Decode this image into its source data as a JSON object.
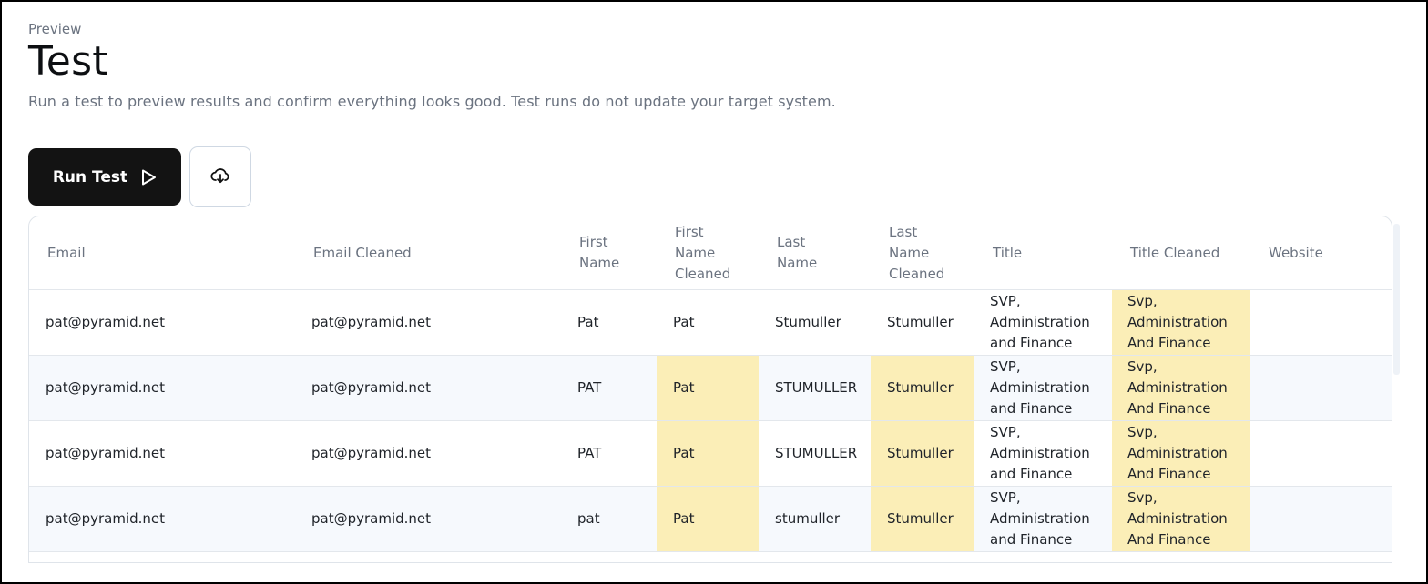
{
  "header": {
    "eyebrow": "Preview",
    "title": "Test",
    "subtitle": "Run a test to preview results and confirm everything looks good. Test runs do not update your target system."
  },
  "toolbar": {
    "run_label": "Run Test",
    "run_icon": "play-icon",
    "download_icon": "cloud-download-icon"
  },
  "colors": {
    "highlight": "#fbeeb7",
    "button": "#131313",
    "alt_row": "#f6f9fd"
  },
  "table": {
    "columns": [
      {
        "lines": [
          "Email"
        ]
      },
      {
        "lines": [
          "Email Cleaned"
        ]
      },
      {
        "lines": [
          "First",
          "Name"
        ]
      },
      {
        "lines": [
          "First",
          "Name",
          "Cleaned"
        ]
      },
      {
        "lines": [
          "Last",
          "Name"
        ]
      },
      {
        "lines": [
          "Last",
          "Name",
          "Cleaned"
        ]
      },
      {
        "lines": [
          "Title"
        ]
      },
      {
        "lines": [
          "Title Cleaned"
        ]
      },
      {
        "lines": [
          "Website"
        ]
      }
    ],
    "rows": [
      {
        "email": "pat@pyramid.net",
        "email_cleaned": "pat@pyramid.net",
        "first": "Pat",
        "first_cleaned": "Pat",
        "last": "Stumuller",
        "last_cleaned": "Stumuller",
        "title": [
          "SVP,",
          "Administration",
          "and Finance"
        ],
        "title_cleaned": [
          "Svp,",
          "Administration",
          "And Finance"
        ],
        "website": "",
        "highlight": [
          "title_cleaned"
        ]
      },
      {
        "email": "pat@pyramid.net",
        "email_cleaned": "pat@pyramid.net",
        "first": "PAT",
        "first_cleaned": "Pat",
        "last": "STUMULLER",
        "last_cleaned": "Stumuller",
        "title": [
          "SVP,",
          "Administration",
          "and Finance"
        ],
        "title_cleaned": [
          "Svp,",
          "Administration",
          "And Finance"
        ],
        "website": "",
        "highlight": [
          "first_cleaned",
          "last_cleaned",
          "title_cleaned"
        ]
      },
      {
        "email": "pat@pyramid.net",
        "email_cleaned": "pat@pyramid.net",
        "first": "PAT",
        "first_cleaned": "Pat",
        "last": "STUMULLER",
        "last_cleaned": "Stumuller",
        "title": [
          "SVP,",
          "Administration",
          "and Finance"
        ],
        "title_cleaned": [
          "Svp,",
          "Administration",
          "And Finance"
        ],
        "website": "",
        "highlight": [
          "first_cleaned",
          "last_cleaned",
          "title_cleaned"
        ]
      },
      {
        "email": "pat@pyramid.net",
        "email_cleaned": "pat@pyramid.net",
        "first": "pat",
        "first_cleaned": "Pat",
        "last": "stumuller",
        "last_cleaned": "Stumuller",
        "title": [
          "SVP,",
          "Administration",
          "and Finance"
        ],
        "title_cleaned": [
          "Svp,",
          "Administration",
          "And Finance"
        ],
        "website": "",
        "highlight": [
          "first_cleaned",
          "last_cleaned",
          "title_cleaned"
        ]
      }
    ]
  }
}
